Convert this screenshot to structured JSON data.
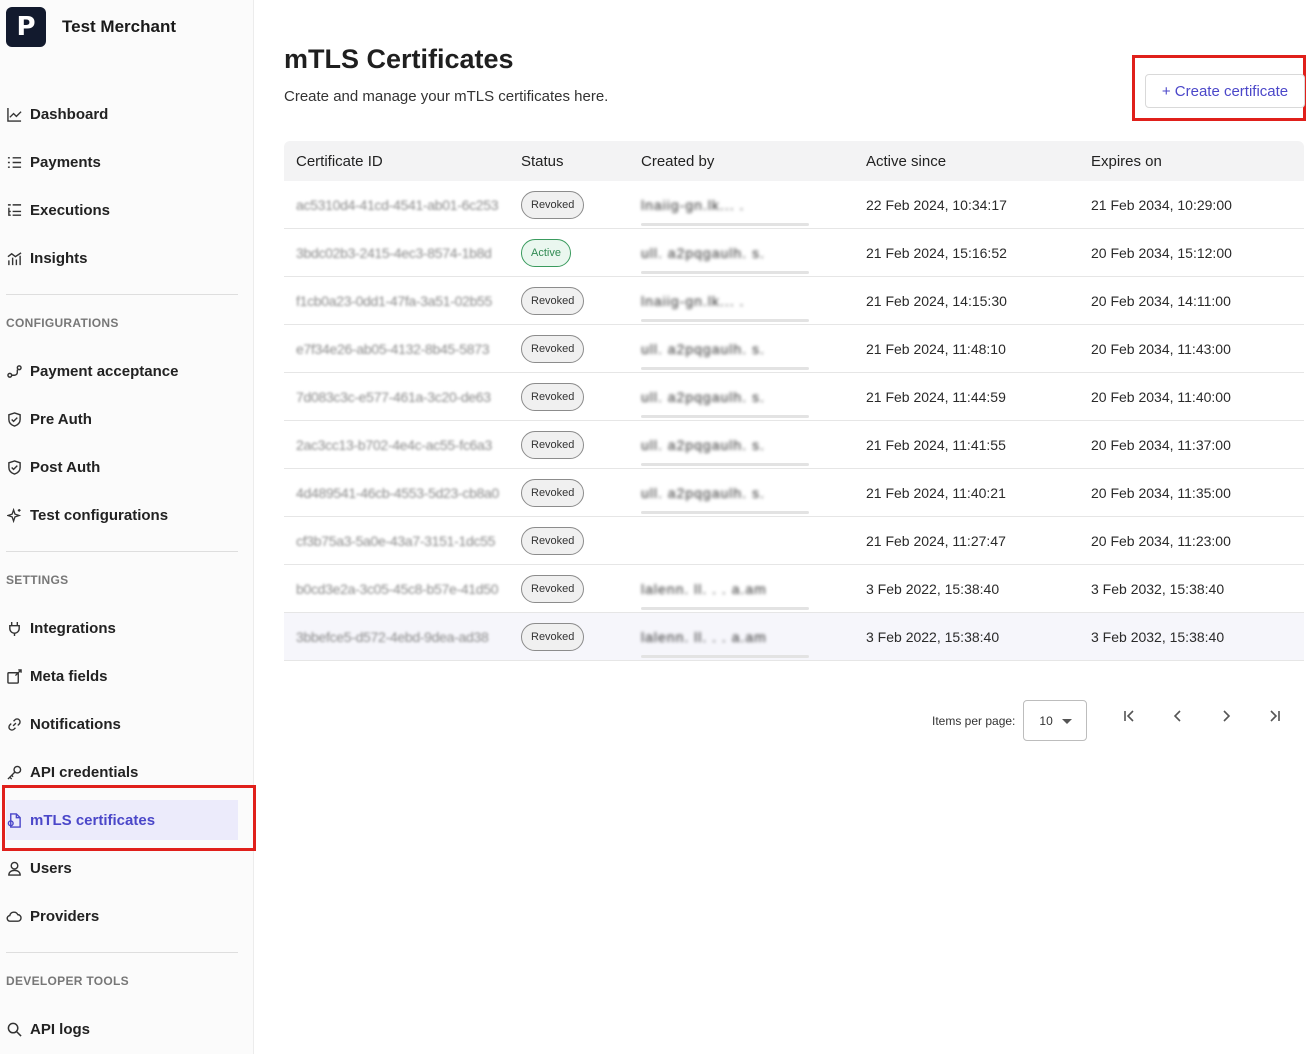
{
  "brand": {
    "logo_letter": "P",
    "name": "Test Merchant"
  },
  "nav": {
    "top": [
      {
        "id": "dashboard",
        "label": "Dashboard",
        "icon": "chart-line-icon"
      },
      {
        "id": "payments",
        "label": "Payments",
        "icon": "list-icon"
      },
      {
        "id": "executions",
        "label": "Executions",
        "icon": "list-checks-icon"
      },
      {
        "id": "insights",
        "label": "Insights",
        "icon": "bar-chart-icon"
      }
    ],
    "configurations_title": "CONFIGURATIONS",
    "configurations": [
      {
        "id": "payment-acceptance",
        "label": "Payment acceptance",
        "icon": "flow-icon"
      },
      {
        "id": "pre-auth",
        "label": "Pre Auth",
        "icon": "shield-icon"
      },
      {
        "id": "post-auth",
        "label": "Post Auth",
        "icon": "shield-icon"
      },
      {
        "id": "test-configurations",
        "label": "Test configurations",
        "icon": "sparkle-icon"
      }
    ],
    "settings_title": "SETTINGS",
    "settings": [
      {
        "id": "integrations",
        "label": "Integrations",
        "icon": "plug-icon"
      },
      {
        "id": "meta-fields",
        "label": "Meta fields",
        "icon": "edit-icon"
      },
      {
        "id": "notifications",
        "label": "Notifications",
        "icon": "link-icon"
      },
      {
        "id": "api-credentials",
        "label": "API credentials",
        "icon": "key-icon"
      },
      {
        "id": "mtls-certificates",
        "label": "mTLS certificates",
        "icon": "certificate-icon",
        "active": true
      },
      {
        "id": "users",
        "label": "Users",
        "icon": "user-icon"
      },
      {
        "id": "providers",
        "label": "Providers",
        "icon": "cloud-icon"
      }
    ],
    "developer_title": "DEVELOPER TOOLS",
    "developer": [
      {
        "id": "api-logs",
        "label": "API logs",
        "icon": "search-icon"
      }
    ]
  },
  "main": {
    "title": "mTLS Certificates",
    "subtitle": "Create and manage your mTLS certificates here.",
    "create_button": "+ Create certificate",
    "columns": [
      "Certificate ID",
      "Status",
      "Created by",
      "Active since",
      "Expires on"
    ],
    "rows": [
      {
        "id": "ac5310d4-41cd-4541-ab01-6c253",
        "status": "Revoked",
        "created_by": "      lnaiig-gn.lk...   .",
        "active_since": "22 Feb 2024, 10:34:17",
        "expires_on": "21 Feb 2034, 10:29:00"
      },
      {
        "id": "3bdc02b3-2415-4ec3-8574-1b8d",
        "status": "Active",
        "created_by": "ull. a2pqgaulh. s.",
        "active_since": "21 Feb 2024, 15:16:52",
        "expires_on": "20 Feb 2034, 15:12:00"
      },
      {
        "id": "f1cb0a23-0dd1-47fa-3a51-02b55",
        "status": "Revoked",
        "created_by": "      lnaiig-gn.lk...   .",
        "active_since": "21 Feb 2024, 14:15:30",
        "expires_on": "20 Feb 2034, 14:11:00"
      },
      {
        "id": "e7f34e26-ab05-4132-8b45-5873",
        "status": "Revoked",
        "created_by": "ull. a2pqgaulh. s.",
        "active_since": "21 Feb 2024, 11:48:10",
        "expires_on": "20 Feb 2034, 11:43:00"
      },
      {
        "id": "7d083c3c-e577-461a-3c20-de63",
        "status": "Revoked",
        "created_by": "ull. a2pqgaulh. s.",
        "active_since": "21 Feb 2024, 11:44:59",
        "expires_on": "20 Feb 2034, 11:40:00"
      },
      {
        "id": "2ac3cc13-b702-4e4c-ac55-fc6a3",
        "status": "Revoked",
        "created_by": "ull. a2pqgaulh. s.",
        "active_since": "21 Feb 2024, 11:41:55",
        "expires_on": "20 Feb 2034, 11:37:00"
      },
      {
        "id": "4d489541-46cb-4553-5d23-cb8a0",
        "status": "Revoked",
        "created_by": "ull. a2pqgaulh. s.",
        "active_since": "21 Feb 2024, 11:40:21",
        "expires_on": "20 Feb 2034, 11:35:00"
      },
      {
        "id": "cf3b75a3-5a0e-43a7-3151-1dc55",
        "status": "Revoked",
        "created_by": "",
        "active_since": "21 Feb 2024, 11:27:47",
        "expires_on": "20 Feb 2034, 11:23:00"
      },
      {
        "id": "b0cd3e2a-3c05-45c8-b57e-41d50",
        "status": "Revoked",
        "created_by": "lalenn.   ll.  .   .  a.am",
        "active_since": "3 Feb 2022, 15:38:40",
        "expires_on": "3 Feb 2032, 15:38:40"
      },
      {
        "id": "3bbefce5-d572-4ebd-9dea-ad38",
        "status": "Revoked",
        "created_by": "lalenn.   ll.  .   .  a.am",
        "active_since": "3 Feb 2022, 15:38:40",
        "expires_on": "3 Feb 2032, 15:38:40"
      }
    ]
  },
  "pagination": {
    "items_per_page_label": "Items per page:",
    "items_per_page": "10"
  },
  "colors": {
    "accent": "#4b47c9",
    "highlight": "#e0201b",
    "active_badge": "#2f8a52"
  }
}
